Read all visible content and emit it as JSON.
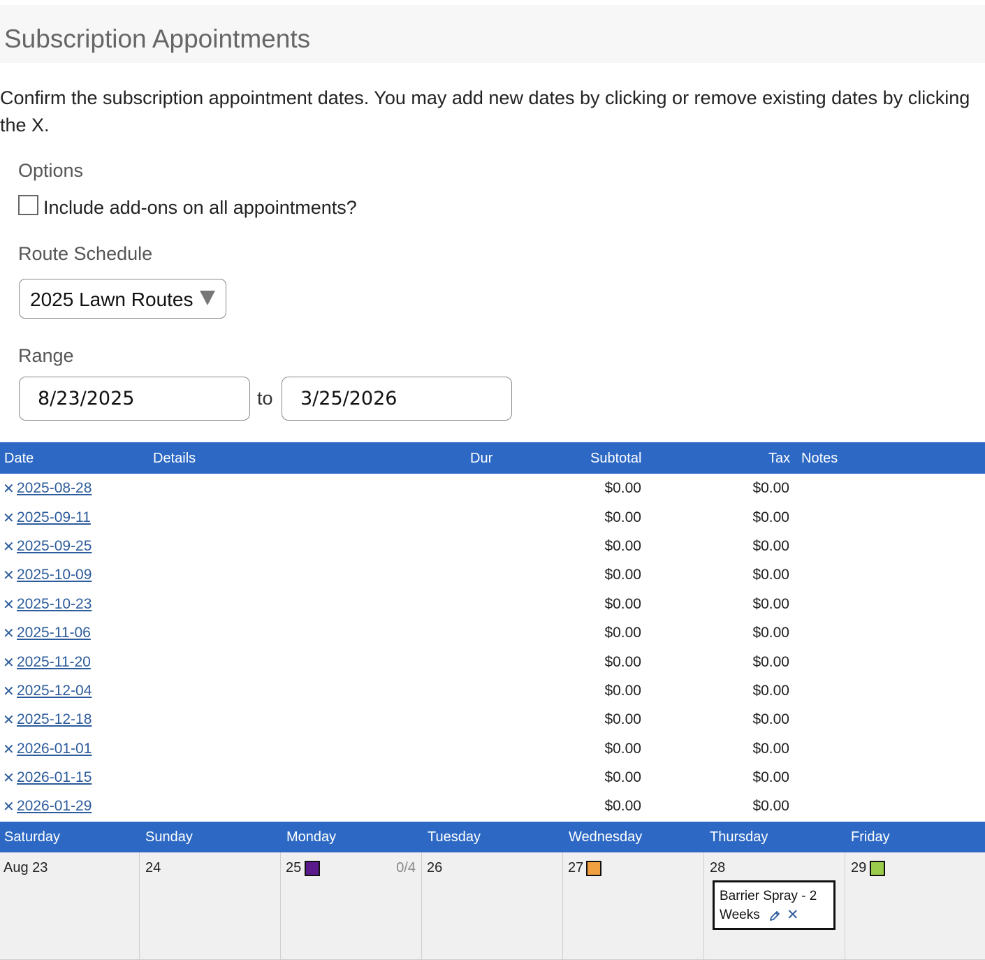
{
  "page_title": "Subscription Appointments",
  "intro_text": "Confirm the subscription appointment dates. You may add new dates by clicking or remove existing dates by clicking the X.",
  "options": {
    "label": "Options",
    "include_addons_label": "Include add-ons on all appointments?",
    "include_addons_checked": false
  },
  "route_schedule": {
    "label": "Route Schedule",
    "selected": "2025 Lawn Routes"
  },
  "range": {
    "label": "Range",
    "start": "8/23/2025",
    "to_label": "to",
    "end": "3/25/2026"
  },
  "table": {
    "columns": {
      "date": "Date",
      "details": "Details",
      "dur": "Dur",
      "subtotal": "Subtotal",
      "tax": "Tax",
      "notes": "Notes"
    },
    "rows": [
      {
        "date": "2025-08-28",
        "subtotal": "$0.00",
        "tax": "$0.00"
      },
      {
        "date": "2025-09-11",
        "subtotal": "$0.00",
        "tax": "$0.00"
      },
      {
        "date": "2025-09-25",
        "subtotal": "$0.00",
        "tax": "$0.00"
      },
      {
        "date": "2025-10-09",
        "subtotal": "$0.00",
        "tax": "$0.00"
      },
      {
        "date": "2025-10-23",
        "subtotal": "$0.00",
        "tax": "$0.00"
      },
      {
        "date": "2025-11-06",
        "subtotal": "$0.00",
        "tax": "$0.00"
      },
      {
        "date": "2025-11-20",
        "subtotal": "$0.00",
        "tax": "$0.00"
      },
      {
        "date": "2025-12-04",
        "subtotal": "$0.00",
        "tax": "$0.00"
      },
      {
        "date": "2025-12-18",
        "subtotal": "$0.00",
        "tax": "$0.00"
      },
      {
        "date": "2026-01-01",
        "subtotal": "$0.00",
        "tax": "$0.00"
      },
      {
        "date": "2026-01-15",
        "subtotal": "$0.00",
        "tax": "$0.00"
      },
      {
        "date": "2026-01-29",
        "subtotal": "$0.00",
        "tax": "$0.00"
      }
    ],
    "remove_glyph": "✕"
  },
  "calendar": {
    "days": [
      "Saturday",
      "Sunday",
      "Monday",
      "Tuesday",
      "Wednesday",
      "Thursday",
      "Friday"
    ],
    "cells": [
      {
        "num": "Aug 23"
      },
      {
        "num": "24"
      },
      {
        "num": "25",
        "swatch": "#5b1a8c",
        "capacity": "0/4"
      },
      {
        "num": "26"
      },
      {
        "num": "27",
        "swatch": "#f0a040"
      },
      {
        "num": "28"
      },
      {
        "num": "29",
        "swatch": "#9ccc4c"
      }
    ],
    "appointment": {
      "title": "Barrier Spray - 2 Weeks",
      "line1": "Barrier Spray - 2",
      "line2": "Weeks",
      "edit_icon": "pencil-icon",
      "remove_glyph": "✕"
    }
  },
  "colors": {
    "header_blue": "#2d69c4",
    "link_blue": "#2d5c9c"
  }
}
